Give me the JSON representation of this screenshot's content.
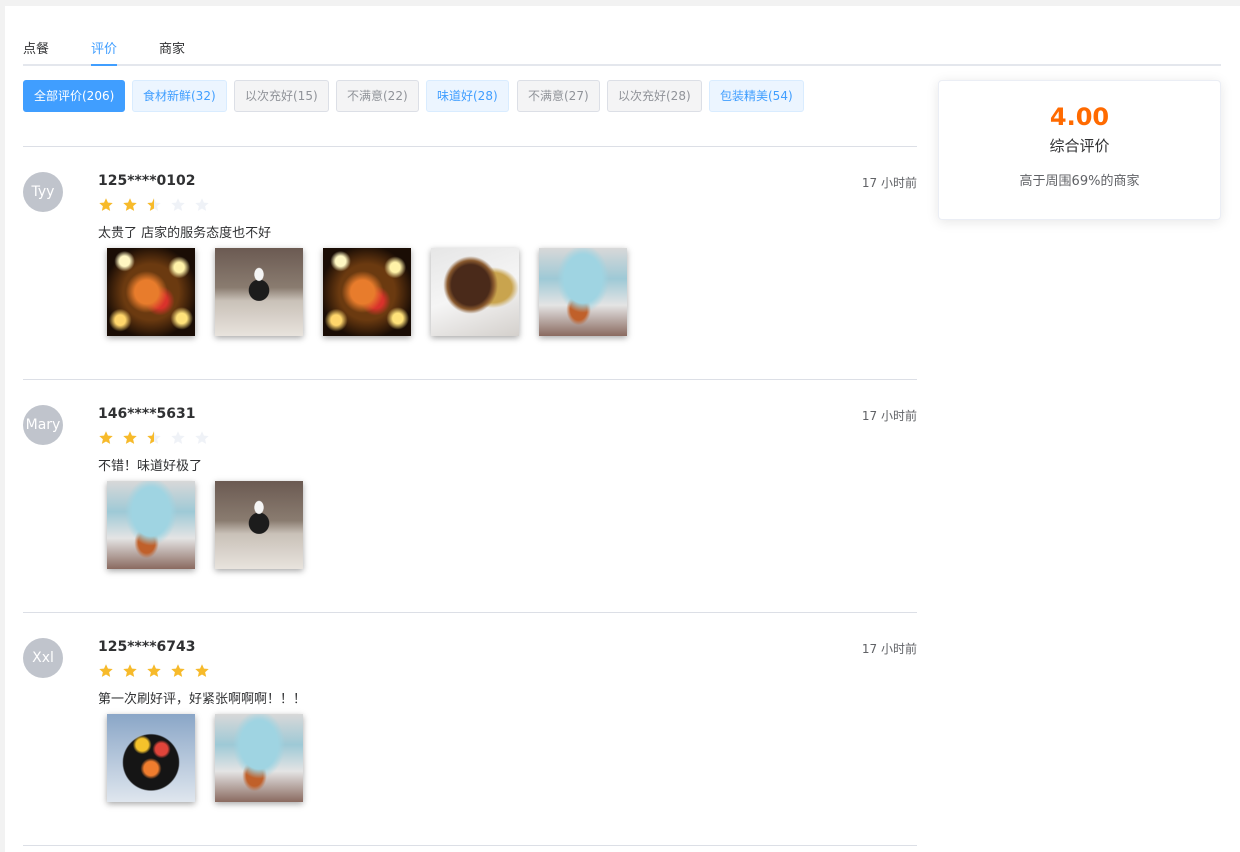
{
  "tabs": [
    {
      "label": "点餐"
    },
    {
      "label": "评价"
    },
    {
      "label": "商家"
    }
  ],
  "filters": [
    {
      "label": "全部评价(206)",
      "style": "selected"
    },
    {
      "label": "食材新鲜(32)",
      "style": "positive"
    },
    {
      "label": "以次充好(15)",
      "style": "negative"
    },
    {
      "label": "不满意(22)",
      "style": "negative"
    },
    {
      "label": "味道好(28)",
      "style": "positive"
    },
    {
      "label": "不满意(27)",
      "style": "negative"
    },
    {
      "label": "以次充好(28)",
      "style": "negative"
    },
    {
      "label": "包装精美(54)",
      "style": "positive"
    }
  ],
  "reviews": [
    {
      "avatar": "Tyy",
      "user": "125****0102",
      "time": "17 小时前",
      "rating": 2.5,
      "comment": "太贵了 店家的服务态度也不好",
      "photos": [
        "cake-glow",
        "chef",
        "cake-glow",
        "pancake",
        "cake-blue"
      ]
    },
    {
      "avatar": "Mary",
      "user": "146****5631",
      "time": "17 小时前",
      "rating": 2.5,
      "comment": "不错！味道好极了",
      "photos": [
        "cake-blue",
        "chef"
      ]
    },
    {
      "avatar": "Xxl",
      "user": "125****6743",
      "time": "17 小时前",
      "rating": 5,
      "comment": "第一次刷好评，好紧张啊啊啊！！！",
      "photos": [
        "fruit-bowl",
        "cake-blue"
      ]
    }
  ],
  "summary": {
    "score": "4.00",
    "label": "综合评价",
    "rank": "高于周围69%的商家"
  },
  "colors": {
    "accent": "#409eff",
    "score": "#ff6a00",
    "star_on": "#f7ba2a",
    "star_off": "#eff2f7"
  }
}
